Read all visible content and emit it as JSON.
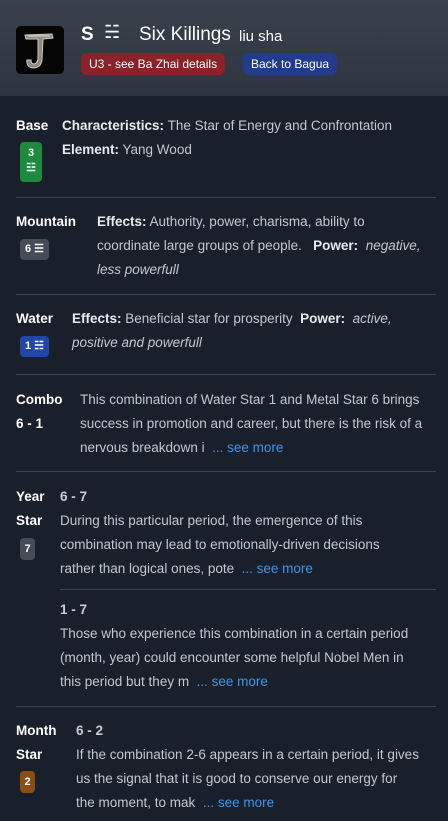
{
  "header": {
    "s_label": "S",
    "trigram": "☵",
    "name": "Six Killings",
    "subtitle": "liu sha",
    "detail_button": "U3 - see Ba Zhai details",
    "back_button": "Back to Bagua"
  },
  "base": {
    "label": "Base",
    "badge_num": "3",
    "badge_sym": "☳",
    "char_label": "Characteristics:",
    "char_value": "The Star of Energy and Confrontation",
    "elem_label": "Element:",
    "elem_value": "Yang Wood"
  },
  "mountain": {
    "label": "Mountain",
    "badge": "6 ☰",
    "effects_label": "Effects:",
    "effects_line1": "Authority, power, charisma, ability to",
    "effects_line2": "coordinate large groups of people.",
    "power_label": "Power:",
    "power_line2": "negative,",
    "power_line3": "less powerfull"
  },
  "water": {
    "label": "Water",
    "badge": "1 ☵",
    "effects_label": "Effects:",
    "effects_value": "Beneficial star for prosperity",
    "power_label": "Power:",
    "power_line1": "active,",
    "power_line2": "positive and powerfull"
  },
  "combo": {
    "label": "Combo",
    "numbers": "6 - 1",
    "line1": "This combination of Water Star 1 and Metal Star 6 brings",
    "line2": "success in promotion and career, but there is the risk of a",
    "line3": "nervous breakdown i",
    "see_more": "... see more"
  },
  "year_star": {
    "label1": "Year",
    "label2": "Star",
    "badge": "7",
    "entry1": {
      "title": "6 - 7",
      "line1": "During this particular period, the emergence of this",
      "line2": "combination may lead to emotionally-driven decisions",
      "line3": "rather than logical ones, pote",
      "see_more": "... see more"
    },
    "entry2": {
      "title": "1 - 7",
      "line1": "Those who experience this combination in a certain period",
      "line2": "(month, year) could encounter some helpful Nobel Men in",
      "line3": "this period but they m",
      "see_more": "... see more"
    }
  },
  "month_star": {
    "label1": "Month",
    "label2": "Star",
    "badge": "2",
    "entry1": {
      "title": "6 - 2",
      "line1": "If the combination 2-6 appears in a certain period, it gives",
      "line2": "us the signal that it is good to conserve our energy for",
      "line3": "the moment, to mak",
      "see_more": "... see more"
    }
  },
  "colors": {
    "background": "#1a202b",
    "header": "#353d48",
    "red_button": "#8b2229",
    "blue_button": "#213c8f",
    "badge_green": "#1d8a3e",
    "badge_gray": "#454c58",
    "badge_blue": "#1f46a8",
    "badge_brown": "#8a4d14",
    "link": "#3b95e8"
  }
}
